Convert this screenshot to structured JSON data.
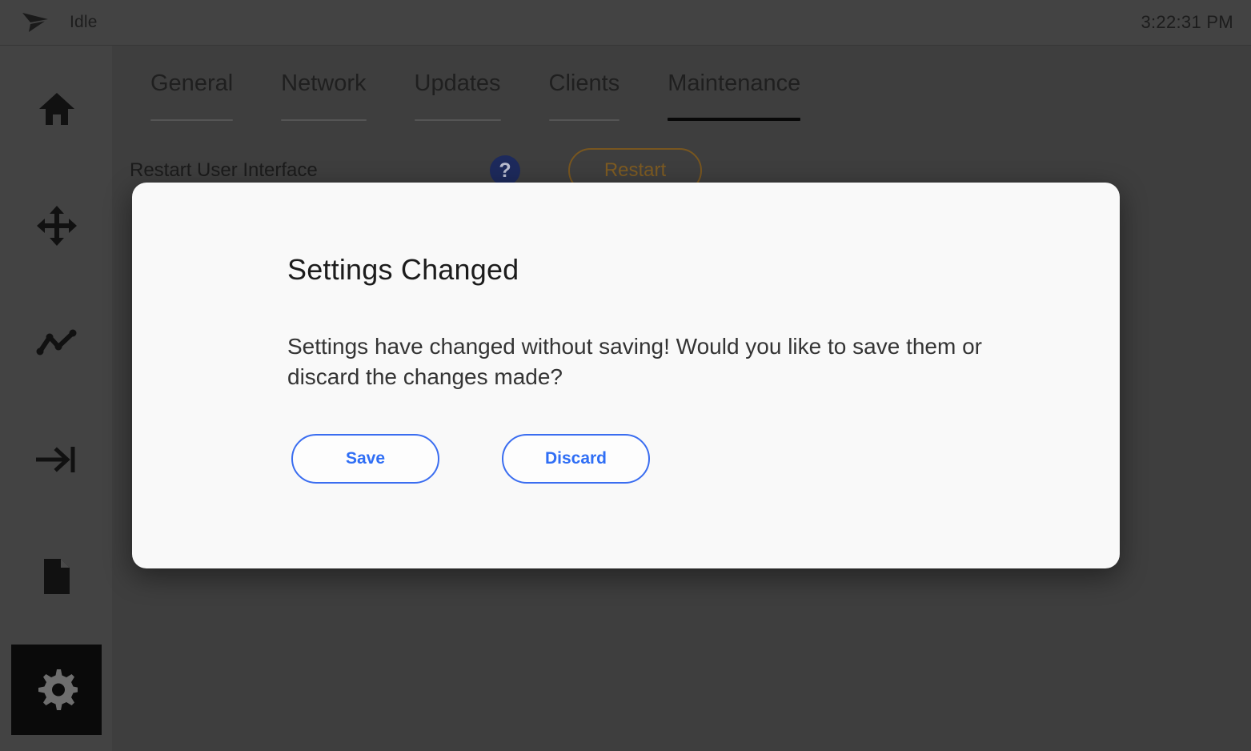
{
  "topbar": {
    "logo_icon": "paper-plane-logo",
    "status": "Idle",
    "clock": "3:22:31 PM"
  },
  "sidebar": {
    "items": [
      {
        "icon": "home-icon",
        "name": "home",
        "selected": false
      },
      {
        "icon": "move-arrows-icon",
        "name": "jog",
        "selected": false
      },
      {
        "icon": "line-chart-icon",
        "name": "monitor",
        "selected": false
      },
      {
        "icon": "arrow-to-bar-icon",
        "name": "homing",
        "selected": false
      },
      {
        "icon": "file-icon",
        "name": "files",
        "selected": false
      },
      {
        "icon": "gear-icon",
        "name": "settings",
        "selected": true
      }
    ]
  },
  "tabs": [
    {
      "label": "General",
      "active": false
    },
    {
      "label": "Network",
      "active": false
    },
    {
      "label": "Updates",
      "active": false
    },
    {
      "label": "Clients",
      "active": false
    },
    {
      "label": "Maintenance",
      "active": true
    }
  ],
  "settings_row": {
    "label": "Restart User Interface",
    "help_icon": "question-mark-icon",
    "help_glyph": "?",
    "action_label": "Restart"
  },
  "modal": {
    "title": "Settings Changed",
    "message": "Settings have changed without saving! Would you like to save them or discard the changes made?",
    "save_label": "Save",
    "discard_label": "Discard"
  },
  "colors": {
    "background": "#3e3e3e",
    "chrome": "#434343",
    "selected_tile": "#0a0a0a",
    "modal_background": "#f9f9f9",
    "accent_blue": "#2f6ef5",
    "help_badge": "#1d2a5c",
    "warning_amber": "#7d5b22",
    "active_tab_underline": "#080808",
    "inactive_tab_underline": "#555555"
  }
}
